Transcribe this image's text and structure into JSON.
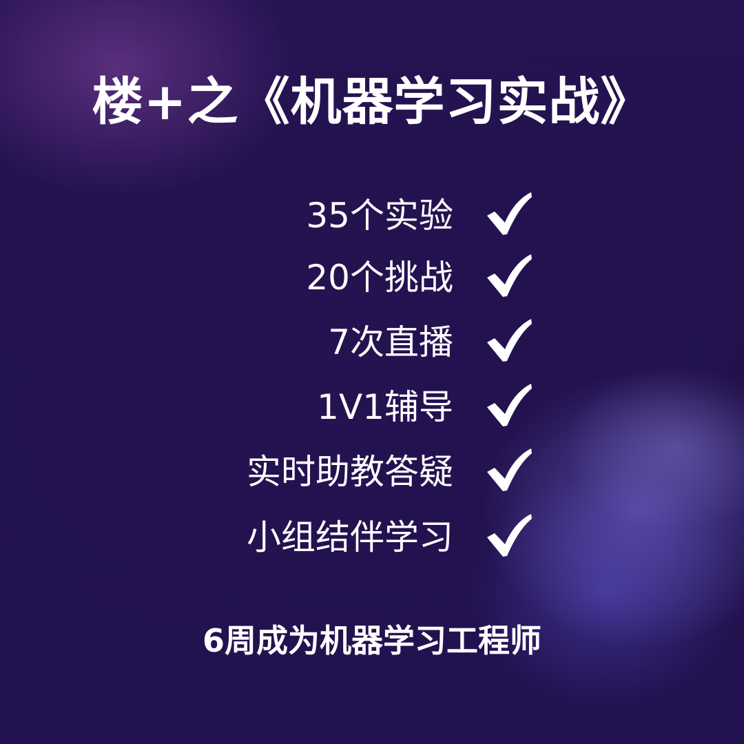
{
  "title": "楼+之《机器学习实战》",
  "features": [
    {
      "label": "35个实验",
      "icon": "check-icon"
    },
    {
      "label": "20个挑战",
      "icon": "check-icon"
    },
    {
      "label": "7次直播",
      "icon": "check-icon"
    },
    {
      "label": "1V1辅导",
      "icon": "check-icon"
    },
    {
      "label": "实时助教答疑",
      "icon": "check-icon"
    },
    {
      "label": "小组结伴学习",
      "icon": "check-icon"
    }
  ],
  "tagline": "6周成为机器学习工程师",
  "colors": {
    "background": "#22124a",
    "text": "#ffffff",
    "glow_top_left": "#8446a0",
    "glow_bottom_right": "#786edc"
  }
}
